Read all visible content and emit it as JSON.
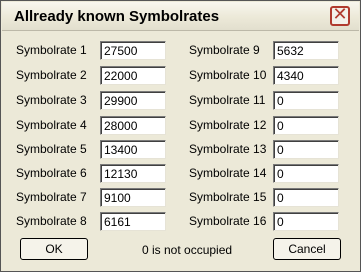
{
  "window": {
    "title": "Allready known Symbolrates",
    "close_glyph": "✕"
  },
  "symbolrates": [
    {
      "label": "Symbolrate 1",
      "value": "27500"
    },
    {
      "label": "Symbolrate 2",
      "value": "22000"
    },
    {
      "label": "Symbolrate 3",
      "value": "29900"
    },
    {
      "label": "Symbolrate 4",
      "value": "28000"
    },
    {
      "label": "Symbolrate 5",
      "value": "13400"
    },
    {
      "label": "Symbolrate 6",
      "value": "12130"
    },
    {
      "label": "Symbolrate 7",
      "value": "9100"
    },
    {
      "label": "Symbolrate 8",
      "value": "6161"
    },
    {
      "label": "Symbolrate 9",
      "value": "5632"
    },
    {
      "label": "Symbolrate 10",
      "value": "4340"
    },
    {
      "label": "Symbolrate 11",
      "value": "0"
    },
    {
      "label": "Symbolrate 12",
      "value": "0"
    },
    {
      "label": "Symbolrate 13",
      "value": "0"
    },
    {
      "label": "Symbolrate 14",
      "value": "0"
    },
    {
      "label": "Symbolrate 15",
      "value": "0"
    },
    {
      "label": "Symbolrate 16",
      "value": "0"
    }
  ],
  "footer": {
    "ok_label": "OK",
    "cancel_label": "Cancel",
    "status_text": "0 is not occupied"
  }
}
